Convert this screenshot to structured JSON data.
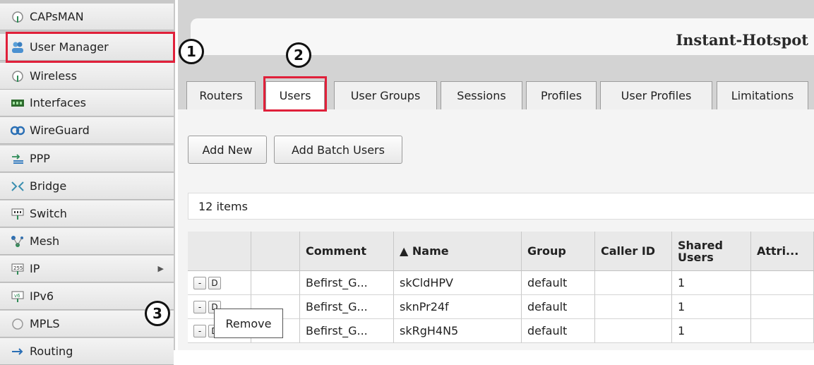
{
  "sidebar": {
    "items": [
      {
        "label": "CAPsMAN",
        "icon": "antenna-icon"
      },
      {
        "label": "User Manager",
        "icon": "users-icon"
      },
      {
        "label": "Wireless",
        "icon": "antenna-icon"
      },
      {
        "label": "Interfaces",
        "icon": "interface-icon"
      },
      {
        "label": "WireGuard",
        "icon": "wireguard-icon"
      },
      {
        "label": "PPP",
        "icon": "ppp-icon"
      },
      {
        "label": "Bridge",
        "icon": "bridge-icon"
      },
      {
        "label": "Switch",
        "icon": "switch-icon"
      },
      {
        "label": "Mesh",
        "icon": "mesh-icon"
      },
      {
        "label": "IP",
        "icon": "ip-icon",
        "submenu": true
      },
      {
        "label": "IPv6",
        "icon": "ipv6-icon"
      },
      {
        "label": "MPLS",
        "icon": "mpls-icon"
      },
      {
        "label": "Routing",
        "icon": "routing-icon"
      }
    ]
  },
  "header": {
    "title": "Instant-Hotspot"
  },
  "tabs": [
    "Routers",
    "Users",
    "User Groups",
    "Sessions",
    "Profiles",
    "User Profiles",
    "Limitations"
  ],
  "active_tab": "Users",
  "toolbar": {
    "add_new": "Add New",
    "add_batch": "Add Batch Users"
  },
  "item_count": "12 items",
  "table": {
    "columns": [
      "",
      "",
      "Comment",
      "▲ Name",
      "Group",
      "Caller ID",
      "Shared Users",
      "Attri..."
    ],
    "row_buttons": {
      "remove": "-",
      "disable": "D"
    },
    "rows": [
      {
        "comment": "Befirst_G...",
        "name": "skCldHPV",
        "group": "default",
        "caller_id": "",
        "shared_users": "1"
      },
      {
        "comment": "Befirst_G...",
        "name": "sknPr24f",
        "group": "default",
        "caller_id": "",
        "shared_users": "1"
      },
      {
        "comment": "Befirst_G...",
        "name": "skRgH4N5",
        "group": "default",
        "caller_id": "",
        "shared_users": "1"
      }
    ]
  },
  "tooltip": "Remove",
  "callouts": [
    "1",
    "2",
    "3"
  ],
  "colors": {
    "highlight": "#e0203a",
    "sidebar_bg": "#e8e8e8",
    "main_bg": "#d3d3d3"
  }
}
